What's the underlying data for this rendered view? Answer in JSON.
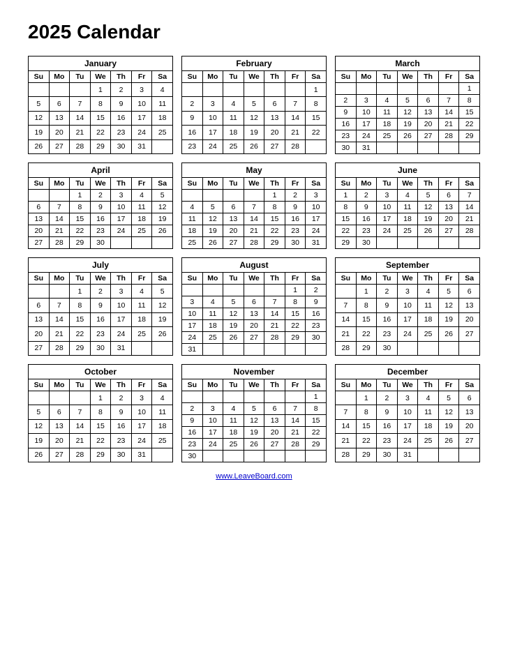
{
  "title": "2025 Calendar",
  "footer": "www.LeaveBoard.com",
  "months": [
    {
      "name": "January",
      "days": [
        "Su",
        "Mo",
        "Tu",
        "We",
        "Th",
        "Fr",
        "Sa"
      ],
      "weeks": [
        [
          "",
          "",
          "",
          "1",
          "2",
          "3",
          "4"
        ],
        [
          "5",
          "6",
          "7",
          "8",
          "9",
          "10",
          "11"
        ],
        [
          "12",
          "13",
          "14",
          "15",
          "16",
          "17",
          "18"
        ],
        [
          "19",
          "20",
          "21",
          "22",
          "23",
          "24",
          "25"
        ],
        [
          "26",
          "27",
          "28",
          "29",
          "30",
          "31",
          ""
        ]
      ]
    },
    {
      "name": "February",
      "days": [
        "Su",
        "Mo",
        "Tu",
        "We",
        "Th",
        "Fr",
        "Sa"
      ],
      "weeks": [
        [
          "",
          "",
          "",
          "",
          "",
          "",
          "1"
        ],
        [
          "2",
          "3",
          "4",
          "5",
          "6",
          "7",
          "8"
        ],
        [
          "9",
          "10",
          "11",
          "12",
          "13",
          "14",
          "15"
        ],
        [
          "16",
          "17",
          "18",
          "19",
          "20",
          "21",
          "22"
        ],
        [
          "23",
          "24",
          "25",
          "26",
          "27",
          "28",
          ""
        ]
      ]
    },
    {
      "name": "March",
      "days": [
        "Su",
        "Mo",
        "Tu",
        "We",
        "Th",
        "Fr",
        "Sa"
      ],
      "weeks": [
        [
          "",
          "",
          "",
          "",
          "",
          "",
          "1"
        ],
        [
          "2",
          "3",
          "4",
          "5",
          "6",
          "7",
          "8"
        ],
        [
          "9",
          "10",
          "11",
          "12",
          "13",
          "14",
          "15"
        ],
        [
          "16",
          "17",
          "18",
          "19",
          "20",
          "21",
          "22"
        ],
        [
          "23",
          "24",
          "25",
          "26",
          "27",
          "28",
          "29"
        ],
        [
          "30",
          "31",
          "",
          "",
          "",
          "",
          ""
        ]
      ]
    },
    {
      "name": "April",
      "days": [
        "Su",
        "Mo",
        "Tu",
        "We",
        "Th",
        "Fr",
        "Sa"
      ],
      "weeks": [
        [
          "",
          "",
          "1",
          "2",
          "3",
          "4",
          "5"
        ],
        [
          "6",
          "7",
          "8",
          "9",
          "10",
          "11",
          "12"
        ],
        [
          "13",
          "14",
          "15",
          "16",
          "17",
          "18",
          "19"
        ],
        [
          "20",
          "21",
          "22",
          "23",
          "24",
          "25",
          "26"
        ],
        [
          "27",
          "28",
          "29",
          "30",
          "",
          "",
          ""
        ]
      ]
    },
    {
      "name": "May",
      "days": [
        "Su",
        "Mo",
        "Tu",
        "We",
        "Th",
        "Fr",
        "Sa"
      ],
      "weeks": [
        [
          "",
          "",
          "",
          "",
          "1",
          "2",
          "3"
        ],
        [
          "4",
          "5",
          "6",
          "7",
          "8",
          "9",
          "10"
        ],
        [
          "11",
          "12",
          "13",
          "14",
          "15",
          "16",
          "17"
        ],
        [
          "18",
          "19",
          "20",
          "21",
          "22",
          "23",
          "24"
        ],
        [
          "25",
          "26",
          "27",
          "28",
          "29",
          "30",
          "31"
        ]
      ]
    },
    {
      "name": "June",
      "days": [
        "Su",
        "Mo",
        "Tu",
        "We",
        "Th",
        "Fr",
        "Sa"
      ],
      "weeks": [
        [
          "1",
          "2",
          "3",
          "4",
          "5",
          "6",
          "7"
        ],
        [
          "8",
          "9",
          "10",
          "11",
          "12",
          "13",
          "14"
        ],
        [
          "15",
          "16",
          "17",
          "18",
          "19",
          "20",
          "21"
        ],
        [
          "22",
          "23",
          "24",
          "25",
          "26",
          "27",
          "28"
        ],
        [
          "29",
          "30",
          "",
          "",
          "",
          "",
          ""
        ]
      ]
    },
    {
      "name": "July",
      "days": [
        "Su",
        "Mo",
        "Tu",
        "We",
        "Th",
        "Fr",
        "Sa"
      ],
      "weeks": [
        [
          "",
          "",
          "1",
          "2",
          "3",
          "4",
          "5"
        ],
        [
          "6",
          "7",
          "8",
          "9",
          "10",
          "11",
          "12"
        ],
        [
          "13",
          "14",
          "15",
          "16",
          "17",
          "18",
          "19"
        ],
        [
          "20",
          "21",
          "22",
          "23",
          "24",
          "25",
          "26"
        ],
        [
          "27",
          "28",
          "29",
          "30",
          "31",
          "",
          ""
        ]
      ]
    },
    {
      "name": "August",
      "days": [
        "Su",
        "Mo",
        "Tu",
        "We",
        "Th",
        "Fr",
        "Sa"
      ],
      "weeks": [
        [
          "",
          "",
          "",
          "",
          "",
          "1",
          "2"
        ],
        [
          "3",
          "4",
          "5",
          "6",
          "7",
          "8",
          "9"
        ],
        [
          "10",
          "11",
          "12",
          "13",
          "14",
          "15",
          "16"
        ],
        [
          "17",
          "18",
          "19",
          "20",
          "21",
          "22",
          "23"
        ],
        [
          "24",
          "25",
          "26",
          "27",
          "28",
          "29",
          "30"
        ],
        [
          "31",
          "",
          "",
          "",
          "",
          "",
          ""
        ]
      ]
    },
    {
      "name": "September",
      "days": [
        "Su",
        "Mo",
        "Tu",
        "We",
        "Th",
        "Fr",
        "Sa"
      ],
      "weeks": [
        [
          "",
          "1",
          "2",
          "3",
          "4",
          "5",
          "6"
        ],
        [
          "7",
          "8",
          "9",
          "10",
          "11",
          "12",
          "13"
        ],
        [
          "14",
          "15",
          "16",
          "17",
          "18",
          "19",
          "20"
        ],
        [
          "21",
          "22",
          "23",
          "24",
          "25",
          "26",
          "27"
        ],
        [
          "28",
          "29",
          "30",
          "",
          "",
          "",
          ""
        ]
      ]
    },
    {
      "name": "October",
      "days": [
        "Su",
        "Mo",
        "Tu",
        "We",
        "Th",
        "Fr",
        "Sa"
      ],
      "weeks": [
        [
          "",
          "",
          "",
          "1",
          "2",
          "3",
          "4"
        ],
        [
          "5",
          "6",
          "7",
          "8",
          "9",
          "10",
          "11"
        ],
        [
          "12",
          "13",
          "14",
          "15",
          "16",
          "17",
          "18"
        ],
        [
          "19",
          "20",
          "21",
          "22",
          "23",
          "24",
          "25"
        ],
        [
          "26",
          "27",
          "28",
          "29",
          "30",
          "31",
          ""
        ]
      ]
    },
    {
      "name": "November",
      "days": [
        "Su",
        "Mo",
        "Tu",
        "We",
        "Th",
        "Fr",
        "Sa"
      ],
      "weeks": [
        [
          "",
          "",
          "",
          "",
          "",
          "",
          "1"
        ],
        [
          "2",
          "3",
          "4",
          "5",
          "6",
          "7",
          "8"
        ],
        [
          "9",
          "10",
          "11",
          "12",
          "13",
          "14",
          "15"
        ],
        [
          "16",
          "17",
          "18",
          "19",
          "20",
          "21",
          "22"
        ],
        [
          "23",
          "24",
          "25",
          "26",
          "27",
          "28",
          "29"
        ],
        [
          "30",
          "",
          "",
          "",
          "",
          "",
          ""
        ]
      ]
    },
    {
      "name": "December",
      "days": [
        "Su",
        "Mo",
        "Tu",
        "We",
        "Th",
        "Fr",
        "Sa"
      ],
      "weeks": [
        [
          "",
          "1",
          "2",
          "3",
          "4",
          "5",
          "6"
        ],
        [
          "7",
          "8",
          "9",
          "10",
          "11",
          "12",
          "13"
        ],
        [
          "14",
          "15",
          "16",
          "17",
          "18",
          "19",
          "20"
        ],
        [
          "21",
          "22",
          "23",
          "24",
          "25",
          "26",
          "27"
        ],
        [
          "28",
          "29",
          "30",
          "31",
          "",
          "",
          ""
        ]
      ]
    }
  ]
}
